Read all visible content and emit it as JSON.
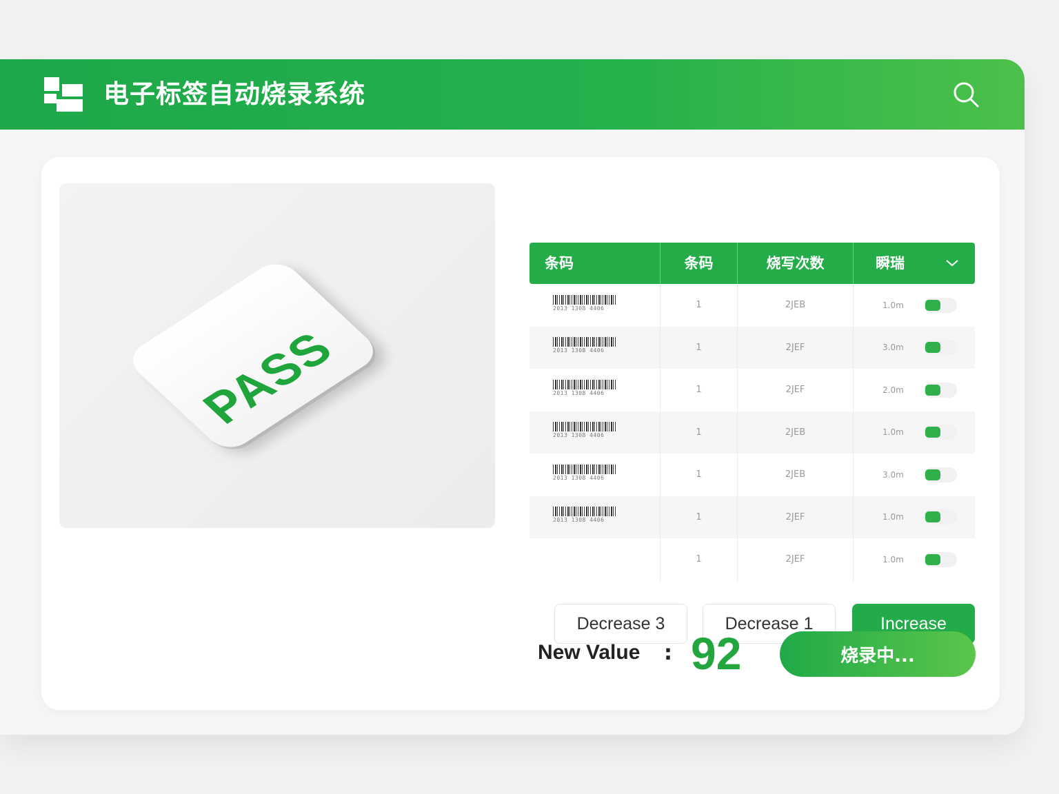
{
  "header": {
    "title": "电子标签自动烧录系统",
    "search_icon": "search-icon",
    "logo_icon": "app-logo-icon"
  },
  "preview": {
    "status_text": "PASS"
  },
  "table": {
    "columns": [
      "条码",
      "条码",
      "烧写次数",
      "瞬瑞"
    ],
    "rows": [
      {
        "digits": "2013 1308 4406",
        "count": "1",
        "value": "2JEB",
        "duration": "1.0m",
        "on": true
      },
      {
        "digits": "2013 1308 4406",
        "count": "1",
        "value": "2JEF",
        "duration": "3.0m",
        "on": true
      },
      {
        "digits": "2013 1308 4406",
        "count": "1",
        "value": "2JEF",
        "duration": "2.0m",
        "on": true
      },
      {
        "digits": "2013 1308 4406",
        "count": "1",
        "value": "2JEB",
        "duration": "1.0m",
        "on": true
      },
      {
        "digits": "2013 1308 4406",
        "count": "1",
        "value": "2JEB",
        "duration": "3.0m",
        "on": true
      },
      {
        "digits": "2013 1308 4406",
        "count": "1",
        "value": "2JEF",
        "duration": "1.0m",
        "on": true
      },
      {
        "digits": "",
        "count": "1",
        "value": "2JEF",
        "duration": "1.0m",
        "on": true
      }
    ]
  },
  "controls": {
    "decrease3": "Decrease 3",
    "decrease1": "Decrease 1",
    "increase": "Increase"
  },
  "result": {
    "label": "New Value",
    "colon": ":",
    "value": "92",
    "burn_button": "烧录中..."
  },
  "colors": {
    "primary_green": "#24ac48",
    "accent_green": "#5cc54b"
  }
}
